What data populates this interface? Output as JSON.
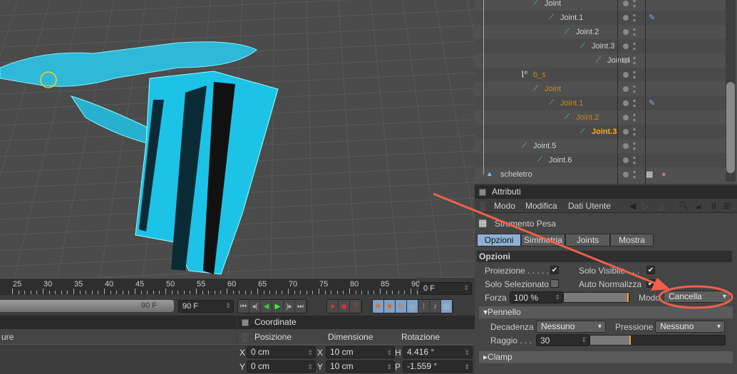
{
  "timeline": {
    "ticks": [
      "25",
      "30",
      "35",
      "40",
      "45",
      "50",
      "55",
      "60",
      "65",
      "70",
      "75",
      "80",
      "85",
      "90"
    ],
    "current_frame": "0 F",
    "end_slider_label": "90 F",
    "end_frame": "90 F"
  },
  "left_panel": {
    "column_header": "ure"
  },
  "coordinates": {
    "title": "Coordinate",
    "columns": [
      "Posizione",
      "Dimensione",
      "Rotazione"
    ],
    "rows": [
      {
        "pos_axis": "X",
        "pos": "0 cm",
        "dim_axis": "X",
        "dim": "10 cm",
        "rot_axis": "H",
        "rot": "4.416 °"
      },
      {
        "pos_axis": "Y",
        "pos": "0 cm",
        "dim_axis": "Y",
        "dim": "10 cm",
        "rot_axis": "P",
        "rot": "-1.559 °"
      }
    ]
  },
  "objects": [
    {
      "name": "Joint",
      "state": "normal",
      "tag": false
    },
    {
      "name": "Joint.1",
      "state": "normal",
      "tag": true
    },
    {
      "name": "Joint.2",
      "state": "normal",
      "tag": false
    },
    {
      "name": "Joint.3",
      "state": "normal",
      "tag": false
    },
    {
      "name": "Joint.4",
      "state": "normal",
      "tag": false
    },
    {
      "name": "b_s",
      "state": "selected",
      "tag": false
    },
    {
      "name": "Joint",
      "state": "selected",
      "tag": false
    },
    {
      "name": "Joint.1",
      "state": "selected",
      "tag": true
    },
    {
      "name": "Joint.2",
      "state": "selected",
      "tag": false
    },
    {
      "name": "Joint.3",
      "state": "active",
      "tag": false
    },
    {
      "name": "Joint.5",
      "state": "normal",
      "tag": false
    },
    {
      "name": "Joint.6",
      "state": "normal",
      "tag": false
    },
    {
      "name": "scheletro",
      "state": "normal",
      "tag": false
    }
  ],
  "attributes": {
    "title": "Attributi",
    "menu": [
      "Modo",
      "Modifica",
      "Dati Utente"
    ],
    "tool_name": "Strumento Pesa",
    "tabs": [
      "Opzioni",
      "Simmetria",
      "Joints",
      "Mostra"
    ],
    "active_tab": "Opzioni",
    "section_title": "Opzioni",
    "proiezione": {
      "label": "Proiezione . . . . .",
      "checked": true
    },
    "solo_visibile": {
      "label": "Solo Visibile . . .",
      "checked": true
    },
    "solo_selezionato": {
      "label": "Solo Selezionato",
      "checked": false
    },
    "auto_normalizza": {
      "label": "Auto Normalizza",
      "checked": true
    },
    "forza": {
      "label": "Forza",
      "value": "100 %",
      "percent": 100
    },
    "modo": {
      "label": "Modo",
      "value": "Cancella"
    },
    "pennello": {
      "title": "Pennello",
      "decadenza_label": "Decadenza",
      "decadenza": "Nessuno",
      "pressione_label": "Pressione",
      "pressione": "Nessuno",
      "raggio_label": "Raggio . . .",
      "raggio": "30",
      "raggio_percent": 30
    },
    "clamp": {
      "title": "Clamp"
    }
  },
  "colors": {
    "accent_tab": "#7ea2c9",
    "annotation": "#f0604a",
    "mesh": "#29c6e8",
    "selected_text": "#c8861e",
    "active_text": "#ffa81a"
  }
}
